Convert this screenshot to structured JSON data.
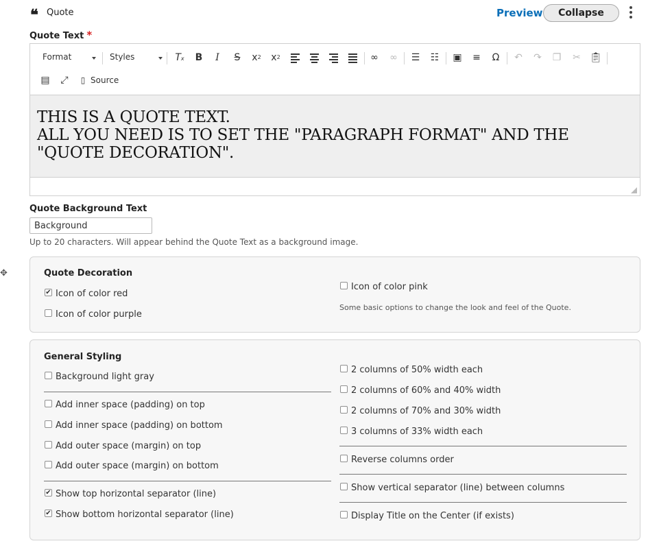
{
  "header": {
    "paragraph_type": "Quote",
    "preview_label": "Preview",
    "collapse_label": "Collapse",
    "quote_icon": "quote-icon",
    "menu_icon": "kebab-menu-icon"
  },
  "quote_text": {
    "label": "Quote Text",
    "required_marker": "*",
    "toolbar": {
      "format_label": "Format",
      "styles_label": "Styles",
      "source_label": "Source",
      "buttons": [
        "remove-format-icon",
        "bold-icon",
        "italic-icon",
        "strikethrough-icon",
        "superscript-icon",
        "subscript-icon",
        "align-left-icon",
        "align-center-icon",
        "align-right-icon",
        "justify-icon",
        "link-icon",
        "unlink-icon",
        "bulleted-list-icon",
        "numbered-list-icon",
        "image-icon",
        "horizontal-line-icon",
        "special-char-icon",
        "undo-icon",
        "redo-icon",
        "copy-icon",
        "cut-icon",
        "paste-icon",
        "show-blocks-icon",
        "maximize-icon",
        "source-icon"
      ]
    },
    "content_lines": [
      "THIS IS A QUOTE TEXT.",
      "ALL YOU NEED IS TO SET THE \"PARAGRAPH FORMAT\" AND THE",
      "\"QUOTE DECORATION\"."
    ]
  },
  "background_text": {
    "label": "Quote Background Text",
    "value": "Background",
    "help": "Up to 20 characters. Will appear behind the Quote Text as a background image."
  },
  "quote_decoration": {
    "title": "Quote Decoration",
    "options": [
      {
        "label": "Icon of color red",
        "checked": true
      },
      {
        "label": "Icon of color purple",
        "checked": false
      },
      {
        "label": "Icon of color pink",
        "checked": false
      }
    ],
    "help": "Some basic options to change the look and feel of the Quote."
  },
  "general_styling": {
    "title": "General Styling",
    "left_options": [
      {
        "label": "Background light gray",
        "checked": false
      },
      {
        "label": "Add inner space (padding) on top",
        "checked": false
      },
      {
        "label": "Add inner space (padding) on bottom",
        "checked": false
      },
      {
        "label": "Add outer space (margin) on top",
        "checked": false
      },
      {
        "label": "Add outer space (margin) on bottom",
        "checked": false
      },
      {
        "label": "Show top horizontal separator (line)",
        "checked": true
      },
      {
        "label": "Show bottom horizontal separator (line)",
        "checked": true
      }
    ],
    "right_options": [
      {
        "label": "2 columns of 50% width each",
        "checked": false
      },
      {
        "label": "2 columns of 60% and 40% width",
        "checked": false
      },
      {
        "label": "2 columns of 70% and 30% width",
        "checked": false
      },
      {
        "label": "3 columns of 33% width each",
        "checked": false
      },
      {
        "label": "Reverse columns order",
        "checked": false
      },
      {
        "label": "Show vertical separator (line) between columns",
        "checked": false
      },
      {
        "label": "Display Title on the Center (if exists)",
        "checked": false
      }
    ]
  },
  "colors": {
    "link": "#0b6fb8",
    "required": "#d72222",
    "editor_bg": "#efefef",
    "fieldset_bg": "#f7f7f7"
  }
}
